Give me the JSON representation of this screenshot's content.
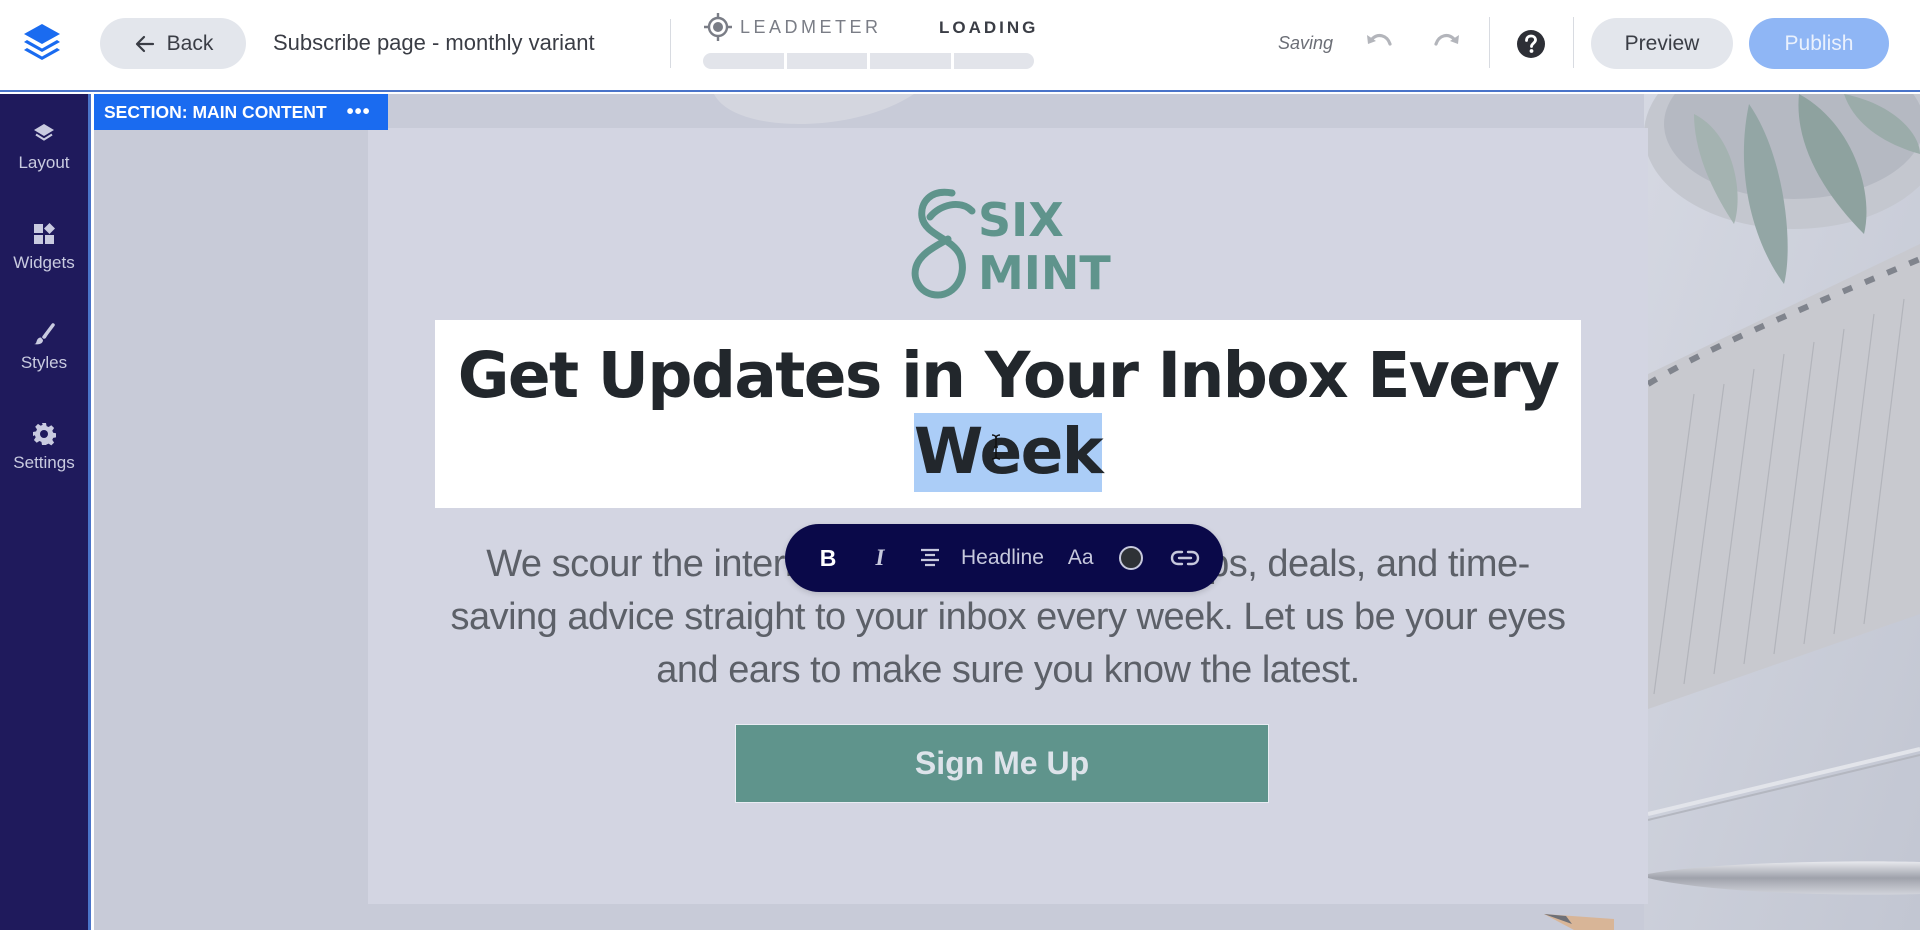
{
  "app": {
    "logo_icon": "stacked-layers-logo-icon",
    "brand_color": "#1a6bf0"
  },
  "header": {
    "back_label": "Back",
    "page_name": "Subscribe page - monthly variant",
    "leadmeter_label": "LEADMETER",
    "leadmeter_status": "LOADING",
    "leadmeter_segments": 4,
    "save_status": "Saving",
    "undo_icon": "undo-icon",
    "redo_icon": "redo-icon",
    "help_icon": "help-circle-icon",
    "preview_label": "Preview",
    "publish_label": "Publish"
  },
  "sidebar": {
    "items": [
      {
        "label": "Layout",
        "icon": "layers-icon"
      },
      {
        "label": "Widgets",
        "icon": "widgets-icon"
      },
      {
        "label": "Styles",
        "icon": "brush-icon"
      },
      {
        "label": "Settings",
        "icon": "gear-icon"
      }
    ]
  },
  "canvas": {
    "section_label": "SECTION: MAIN CONTENT",
    "section_menu": "•••",
    "brand_logo": {
      "line1": "SIX",
      "line2": "MINT",
      "color": "#5f948c"
    },
    "headline": {
      "text_before": "Get Updates in Your Inbox Every ",
      "selected_text": "Week"
    },
    "body_copy": "We scour the internet to bring you the best tips, deals, and time-saving advice straight to your inbox every week. Let us be your eyes and ears to make sure you know the latest.",
    "cta_label": "Sign Me Up",
    "cta_color": "#5f948c"
  },
  "format_toolbar": {
    "bold_label": "B",
    "italic_label": "I",
    "align_icon": "align-center-icon",
    "style_label": "Headline",
    "font_label": "Aa",
    "text_color": "#2f3236",
    "link_icon": "link-icon"
  }
}
